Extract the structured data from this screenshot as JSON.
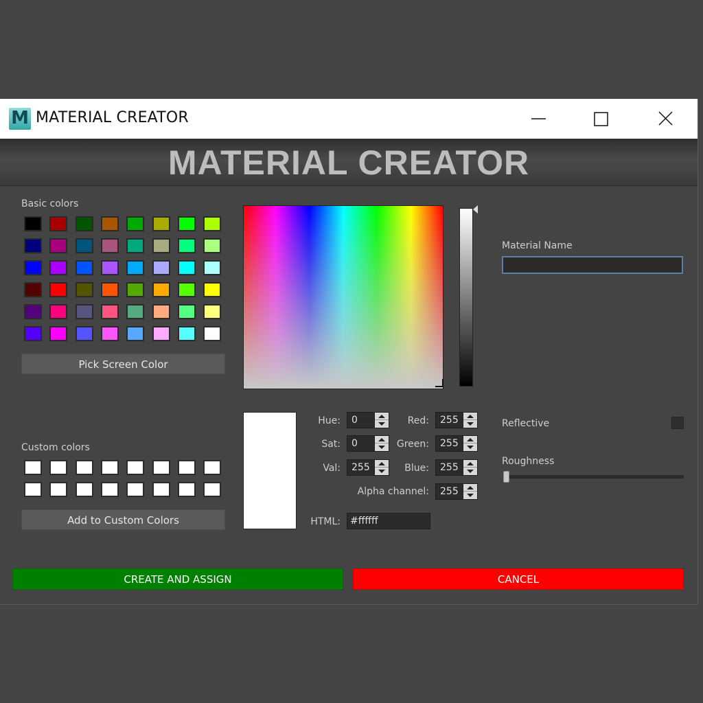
{
  "window": {
    "title": "MATERIAL CREATOR",
    "app_icon_letter": "M",
    "banner": "MATERIAL CREATOR"
  },
  "color_dialog": {
    "basic_colors_label": "Basic colors",
    "basic_colors": [
      [
        "#000000",
        "#aa0000",
        "#005500",
        "#aa5500",
        "#00aa00",
        "#aaaa00",
        "#00ff00",
        "#aaff00"
      ],
      [
        "#00007f",
        "#aa007f",
        "#00557f",
        "#aa557f",
        "#00aa7f",
        "#aaaa7f",
        "#00ff7f",
        "#aaff7f"
      ],
      [
        "#0000ff",
        "#aa00ff",
        "#0055ff",
        "#aa55ff",
        "#00aaff",
        "#aaaaff",
        "#00ffff",
        "#aaffff"
      ],
      [
        "#550000",
        "#ff0000",
        "#555500",
        "#ff5500",
        "#55aa00",
        "#ffaa00",
        "#55ff00",
        "#ffff00"
      ],
      [
        "#55007f",
        "#ff007f",
        "#55557f",
        "#ff557f",
        "#55aa7f",
        "#ffaa7f",
        "#55ff7f",
        "#ffff7f"
      ],
      [
        "#5500ff",
        "#ff00ff",
        "#5555ff",
        "#ff55ff",
        "#55aaff",
        "#ffaaff",
        "#55ffff",
        "#ffffff"
      ]
    ],
    "pick_screen_color": "Pick Screen Color",
    "custom_colors_label": "Custom colors",
    "custom_colors": [
      [
        "#ffffff",
        "#ffffff",
        "#ffffff",
        "#ffffff",
        "#ffffff",
        "#ffffff",
        "#ffffff",
        "#ffffff"
      ],
      [
        "#ffffff",
        "#ffffff",
        "#ffffff",
        "#ffffff",
        "#ffffff",
        "#ffffff",
        "#ffffff",
        "#ffffff"
      ]
    ],
    "add_custom": "Add to Custom Colors",
    "preview_color": "#ffffff",
    "fields": {
      "hue": {
        "label": "Hue:",
        "value": "0"
      },
      "sat": {
        "label": "Sat:",
        "value": "0"
      },
      "val": {
        "label": "Val:",
        "value": "255"
      },
      "red": {
        "label": "Red:",
        "value": "255"
      },
      "green": {
        "label": "Green:",
        "value": "255"
      },
      "blue": {
        "label": "Blue:",
        "value": "255"
      },
      "alpha": {
        "label": "Alpha channel:",
        "value": "255"
      }
    },
    "html_label": "HTML:",
    "html_value": "#ffffff"
  },
  "material": {
    "name_label": "Material Name",
    "name_value": "",
    "reflective_label": "Reflective",
    "reflective_checked": false,
    "roughness_label": "Roughness",
    "roughness_value": 0
  },
  "actions": {
    "create": "CREATE AND ASSIGN",
    "cancel": "CANCEL"
  },
  "colors": {
    "create_bg": "#008000",
    "cancel_bg": "#ff0000",
    "background": "#444444"
  }
}
